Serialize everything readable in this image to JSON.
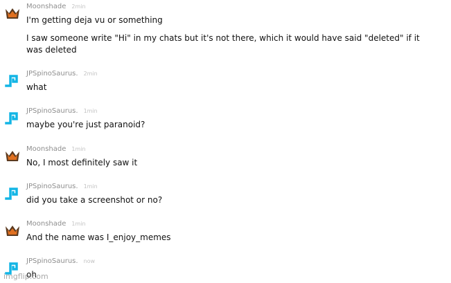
{
  "messages": [
    {
      "user": "Moonshade",
      "avatar": "crown-icon",
      "time": "2min",
      "lines": [
        "I'm getting deja vu or something",
        "I saw someone write \"Hi\" in my chats but it's not there, which it would have said \"deleted\" if it",
        "was deleted"
      ]
    },
    {
      "user": "JPSpinoSaurus.",
      "avatar": "blue-spiral-icon",
      "time": "2min",
      "lines": [
        "what"
      ]
    },
    {
      "user": "JPSpinoSaurus.",
      "avatar": "blue-spiral-icon",
      "time": "1min",
      "lines": [
        "maybe you're just paranoid?"
      ]
    },
    {
      "user": "Moonshade",
      "avatar": "crown-icon",
      "time": "1min",
      "lines": [
        "No, I most definitely saw it"
      ]
    },
    {
      "user": "JPSpinoSaurus.",
      "avatar": "blue-spiral-icon",
      "time": "1min",
      "lines": [
        "did you take a screenshot or no?"
      ]
    },
    {
      "user": "Moonshade",
      "avatar": "crown-icon",
      "time": "1min",
      "lines": [
        "And the name was I_enjoy_memes"
      ]
    },
    {
      "user": "JPSpinoSaurus.",
      "avatar": "blue-spiral-icon",
      "time": "now",
      "lines": [
        "oh"
      ]
    }
  ],
  "watermark": "imgflip.com",
  "colors": {
    "crown_dark": "#5b3a1f",
    "crown_orange": "#e07020",
    "spiral_blue": "#13b5e5",
    "name_gray": "#8e8e8e",
    "time_gray": "#c2c2c2",
    "text": "#111111"
  }
}
